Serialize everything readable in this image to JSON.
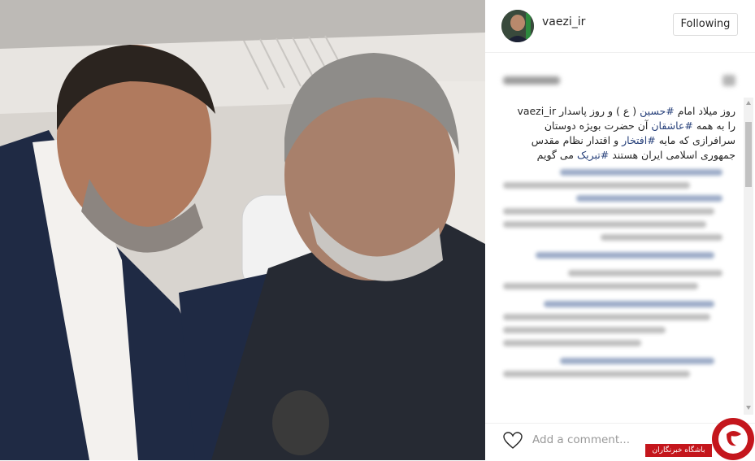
{
  "post": {
    "username": "vaezi_ir",
    "follow_label": "Following"
  },
  "caption": {
    "username": "vaezi_ir",
    "segments": [
      {
        "text": "روز میلاد امام ",
        "tag": false
      },
      {
        "text": "#حسین",
        "tag": true
      },
      {
        "text": " ( ع ) و روز پاسدار ",
        "tag": false
      }
    ],
    "line2_pre": "را به همه ",
    "line2_tag": "#عاشقان",
    "line2_post": " آن حضرت بویژه دوستان",
    "line3_pre": "سرافرازی که مایه ",
    "line3_tag": "#افتخار",
    "line3_post": " و اقتدار نظام مقدس",
    "line4_pre": "جمهوری اسلامی ایران هستند  ",
    "line4_tag": "#تبریک",
    "line4_post": " می گویم"
  },
  "footer": {
    "comment_placeholder": "Add a comment..."
  },
  "watermark": {
    "text": "باشگاه خبرنگاران"
  },
  "colors": {
    "hashtag": "#27407a",
    "watermark_red": "#c4161c"
  }
}
